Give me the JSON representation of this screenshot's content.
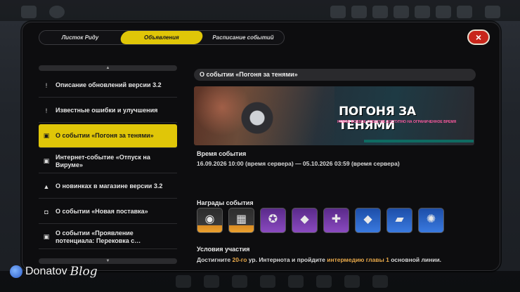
{
  "tabs": {
    "t1": "Листок Риду",
    "t2": "Объявления",
    "t3": "Расписание событий"
  },
  "close_icon": "×",
  "list": {
    "items": [
      {
        "label": "Описание обновлений версии 3.2",
        "icon": "!"
      },
      {
        "label": "Известные ошибки и улучшения",
        "icon": "!"
      },
      {
        "label": "О событии «Погоня за тенями»",
        "icon": "▣"
      },
      {
        "label": "Интернет-событие «Отпуск на Вируме»",
        "icon": "▣"
      },
      {
        "label": "О новинках в магазине версии 3.2",
        "icon": "▲"
      },
      {
        "label": "О событии «Новая поставка»",
        "icon": "◘"
      },
      {
        "label": "О событии «Проявление потенциала: Перековка с…",
        "icon": "▣"
      }
    ]
  },
  "content": {
    "title": "О событии «Погоня за тенями»",
    "banner_title": "ПОГОНЯ ЗА ТЕНЯМИ",
    "banner_sub": "НОВОЕ БОЕВОЕ СОБЫТИЕ ДОСТУПНО НА ОГРАНИЧЕННОЕ ВРЕМЯ",
    "time_heading": "Время события",
    "time_text": "16.09.2026 10:00 (время сервера) — 05.10.2026 03:59 (время сервера)",
    "rewards_heading": "Награды события",
    "rewards": [
      {
        "name": "reward-tire-icon",
        "style": "orange",
        "glyph": "◉"
      },
      {
        "name": "reward-film-icon",
        "style": "orange",
        "glyph": "▦"
      },
      {
        "name": "reward-gear-icon",
        "style": "purple",
        "glyph": "✪"
      },
      {
        "name": "reward-car-pink-icon",
        "style": "purple",
        "glyph": "◆"
      },
      {
        "name": "reward-paint-icon",
        "style": "purple",
        "glyph": "✚"
      },
      {
        "name": "reward-car-blue-icon",
        "style": "blue",
        "glyph": "◆"
      },
      {
        "name": "reward-kit-blue-icon",
        "style": "blue",
        "glyph": "▰"
      },
      {
        "name": "reward-wheel-blue-icon",
        "style": "blue",
        "glyph": "✺"
      }
    ],
    "conditions_heading": "Условия участия",
    "cond_pre": "Достигните ",
    "cond_level": "20-го",
    "cond_mid": " ур. Интернота и пройдите ",
    "cond_chapter": "интермедию главы 1",
    "cond_post": " основной линии."
  },
  "watermark": {
    "brand": "Donatov",
    "blog": "Blog"
  },
  "colors": {
    "accent": "#e0c608",
    "close": "#c8261b",
    "highlight": "#e7a84a"
  }
}
